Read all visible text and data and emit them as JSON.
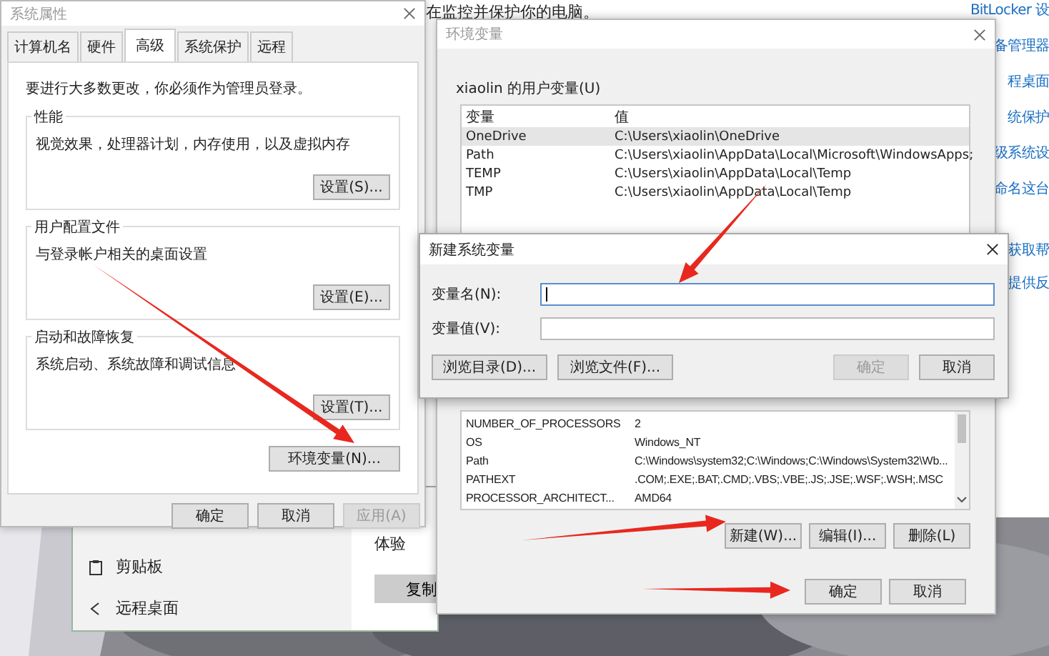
{
  "background_page": {
    "heading": "在监控并保护你的电脑。",
    "links": [
      "BitLocker 设",
      "备管理器",
      "程桌面",
      "统保护",
      "级系统设",
      "命名这台"
    ],
    "help_links": [
      "获取帮",
      "提供反"
    ]
  },
  "settings_window": {
    "nav_items": [
      {
        "label": "剪贴板",
        "kind": "clipboard"
      },
      {
        "label": "远程桌面",
        "kind": "remote"
      }
    ],
    "section_label": "体验",
    "button": "复制"
  },
  "system_properties": {
    "title": "系统属性",
    "tabs": [
      {
        "label": "计算机名",
        "selected": false
      },
      {
        "label": "硬件",
        "selected": false
      },
      {
        "label": "高级",
        "selected": true
      },
      {
        "label": "系统保护",
        "selected": false
      },
      {
        "label": "远程",
        "selected": false
      }
    ],
    "notice": "要进行大多数更改，你必须作为管理员登录。",
    "groups": [
      {
        "title": "性能",
        "description": "视觉效果，处理器计划，内存使用，以及虚拟内存",
        "button": "设置(S)..."
      },
      {
        "title": "用户配置文件",
        "description": "与登录帐户相关的桌面设置",
        "button": "设置(E)..."
      },
      {
        "title": "启动和故障恢复",
        "description": "系统启动、系统故障和调试信息",
        "button": "设置(T)..."
      }
    ],
    "env_button": "环境变量(N)...",
    "buttons": [
      {
        "label": "确定",
        "disabled": false
      },
      {
        "label": "取消",
        "disabled": false
      },
      {
        "label": "应用(A)",
        "disabled": true
      }
    ]
  },
  "environment_variables": {
    "title": "环境变量",
    "user_group": "xiaolin 的用户变量(U)",
    "columns": [
      "变量",
      "值"
    ],
    "user_rows": [
      {
        "name": "OneDrive",
        "value": "C:\\Users\\xiaolin\\OneDrive",
        "selected": true
      },
      {
        "name": "Path",
        "value": "C:\\Users\\xiaolin\\AppData\\Local\\Microsoft\\WindowsApps;",
        "selected": false
      },
      {
        "name": "TEMP",
        "value": "C:\\Users\\xiaolin\\AppData\\Local\\Temp",
        "selected": false
      },
      {
        "name": "TMP",
        "value": "C:\\Users\\xiaolin\\AppData\\Local\\Temp",
        "selected": false
      }
    ],
    "system_rows": [
      {
        "name": "NUMBER_OF_PROCESSORS",
        "value": "2",
        "selected": false
      },
      {
        "name": "OS",
        "value": "Windows_NT",
        "selected": false
      },
      {
        "name": "Path",
        "value": "C:\\Windows\\system32;C:\\Windows;C:\\Windows\\System32\\Wb...",
        "selected": false
      },
      {
        "name": "PATHEXT",
        "value": ".COM;.EXE;.BAT;.CMD;.VBS;.VBE;.JS;.JSE;.WSF;.WSH;.MSC",
        "selected": false
      },
      {
        "name": "PROCESSOR_ARCHITECT...",
        "value": "AMD64",
        "selected": false
      }
    ],
    "system_buttons": [
      "新建(W)...",
      "编辑(I)...",
      "删除(L)"
    ],
    "buttons": [
      "确定",
      "取消"
    ]
  },
  "new_variable_dialog": {
    "title": "新建系统变量",
    "fields": [
      {
        "label": "变量名(N):",
        "focused": true
      },
      {
        "label": "变量值(V):",
        "focused": false
      }
    ],
    "buttons": [
      {
        "label": "浏览目录(D)...",
        "disabled": false
      },
      {
        "label": "浏览文件(F)...",
        "disabled": false
      },
      {
        "label": "确定",
        "disabled": true
      },
      {
        "label": "取消",
        "disabled": false
      }
    ]
  }
}
